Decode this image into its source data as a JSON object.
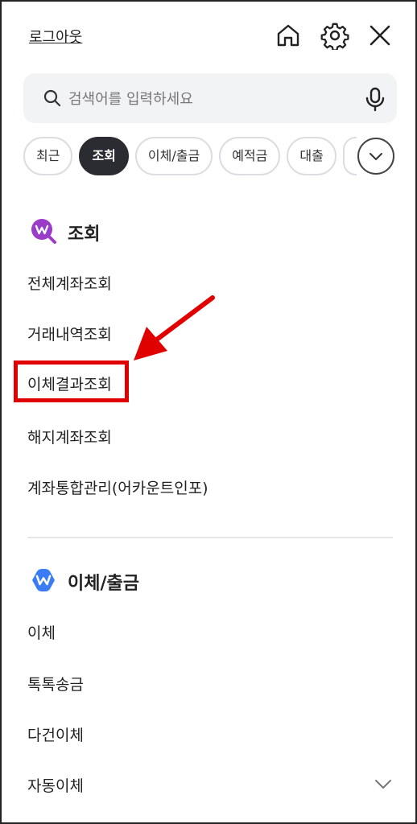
{
  "header": {
    "logout_label": "로그아웃",
    "icons": [
      "home-icon",
      "settings-icon",
      "close-icon"
    ]
  },
  "search": {
    "placeholder": "검색어를 입력하세요",
    "value": ""
  },
  "tabs": [
    {
      "label": "최근",
      "active": false
    },
    {
      "label": "조회",
      "active": true
    },
    {
      "label": "이체/출금",
      "active": false
    },
    {
      "label": "예적금",
      "active": false
    },
    {
      "label": "대출",
      "active": false
    }
  ],
  "sections": [
    {
      "title": "조회",
      "icon": "search-w-icon",
      "items": [
        "전체계좌조회",
        "거래내역조회",
        "이체결과조회",
        "해지계좌조회",
        "계좌통합관리(어카운트인포)"
      ]
    },
    {
      "title": "이체/출금",
      "icon": "w-logo-icon",
      "items": [
        "이체",
        "톡톡송금",
        "다건이체",
        "자동이체"
      ]
    }
  ],
  "colors": {
    "active_tab": "#2b2c31",
    "search_bg": "#f2f3f5",
    "annotation_red": "#e10000",
    "query_icon": "#9b3cc9",
    "transfer_icon": "#3a7bf6"
  }
}
